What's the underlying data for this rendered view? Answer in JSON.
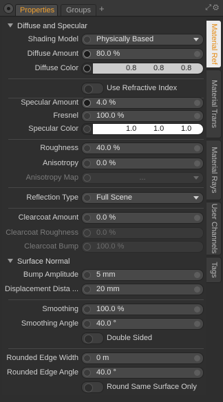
{
  "tabs": {
    "properties": "Properties",
    "groups": "Groups",
    "add": "+"
  },
  "side_tabs": [
    "Material Ref",
    "Material Trans",
    "Material Rays",
    "User Channels",
    "Tags"
  ],
  "sections": {
    "diffuse_specular": "Diffuse and Specular",
    "surface_normal": "Surface Normal"
  },
  "fields": {
    "shading_model": {
      "label": "Shading Model",
      "value": "Physically Based"
    },
    "diffuse_amount": {
      "label": "Diffuse Amount",
      "value": "80.0 %"
    },
    "diffuse_color": {
      "label": "Diffuse Color",
      "r": "0.8",
      "g": "0.8",
      "b": "0.8"
    },
    "use_refractive": {
      "label": "Use Refractive Index"
    },
    "specular_amount": {
      "label": "Specular Amount",
      "value": "4.0 %"
    },
    "fresnel": {
      "label": "Fresnel",
      "value": "100.0 %"
    },
    "specular_color": {
      "label": "Specular Color",
      "r": "1.0",
      "g": "1.0",
      "b": "1.0"
    },
    "roughness": {
      "label": "Roughness",
      "value": "40.0 %"
    },
    "anisotropy": {
      "label": "Anisotropy",
      "value": "0.0 %"
    },
    "anisotropy_map": {
      "label": "Anisotropy Map",
      "value": "..."
    },
    "reflection_type": {
      "label": "Reflection Type",
      "value": "Full Scene"
    },
    "clearcoat_amount": {
      "label": "Clearcoat Amount",
      "value": "0.0 %"
    },
    "clearcoat_roughness": {
      "label": "Clearcoat Roughness",
      "value": "0.0 %"
    },
    "clearcoat_bump": {
      "label": "Clearcoat Bump",
      "value": "100.0 %"
    },
    "bump_amplitude": {
      "label": "Bump Amplitude",
      "value": "5 mm"
    },
    "displacement_distance": {
      "label": "Displacement Dista ...",
      "value": "20 mm"
    },
    "smoothing": {
      "label": "Smoothing",
      "value": "100.0 %"
    },
    "smoothing_angle": {
      "label": "Smoothing Angle",
      "value": "40.0 °"
    },
    "double_sided": {
      "label": "Double Sided"
    },
    "rounded_edge_width": {
      "label": "Rounded Edge Width",
      "value": "0 m"
    },
    "rounded_edge_angle": {
      "label": "Rounded Edge Angle",
      "value": "40.0 °"
    },
    "round_same_surface": {
      "label": "Round Same Surface Only"
    }
  },
  "colors": {
    "accent": "#f0a030",
    "diffuse_swatch": "#cccccc",
    "specular_swatch": "#ffffff"
  }
}
